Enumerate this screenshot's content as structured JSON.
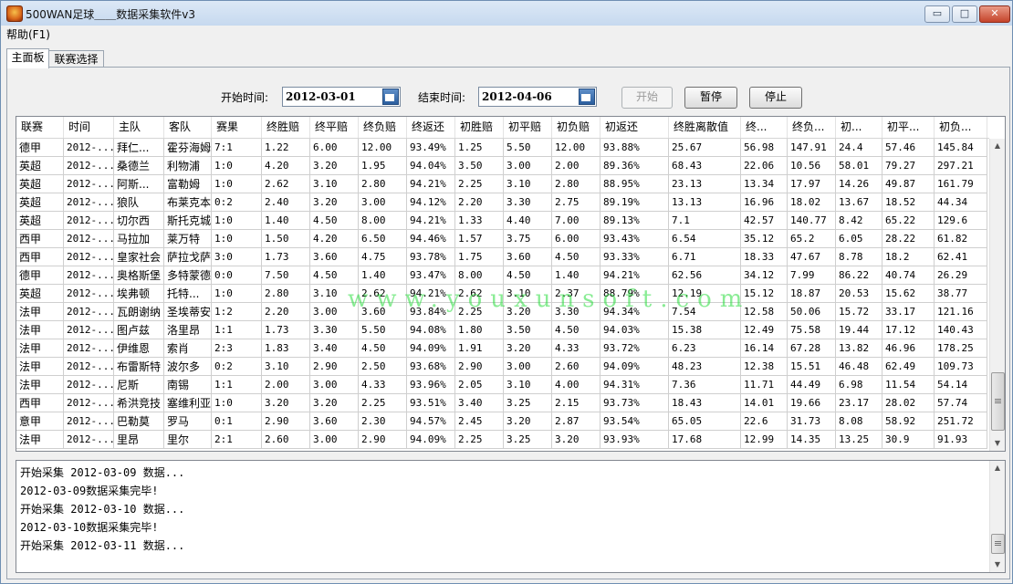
{
  "window": {
    "title": "500WAN足球＿＿数据采集软件v3",
    "minimize": "▭",
    "maximize": "□",
    "close": "✕"
  },
  "menu": {
    "help": "帮助(F1)"
  },
  "tabs": [
    "主面板",
    "联赛选择"
  ],
  "controls": {
    "start_label": "开始时间:",
    "start_value": "2012-03-01",
    "end_label": "结束时间:",
    "end_value": "2012-04-06",
    "btn_start": "开始",
    "btn_pause": "暂停",
    "btn_stop": "停止"
  },
  "table": {
    "headers": [
      "联赛",
      "时间",
      "主队",
      "客队",
      "赛果",
      "终胜赔",
      "终平赔",
      "终负赔",
      "终返还",
      "初胜赔",
      "初平赔",
      "初负赔",
      "初返还",
      "终胜离散值",
      "终...",
      "终负...",
      "初...",
      "初平...",
      "初负..."
    ],
    "rows": [
      [
        "德甲",
        "2012-...",
        "拜仁...",
        "霍芬海姆",
        "7:1",
        "1.22",
        "6.00",
        "12.00",
        "93.49%",
        "1.25",
        "5.50",
        "12.00",
        "93.88%",
        "25.67",
        "56.98",
        "147.91",
        "24.4",
        "57.46",
        "145.84"
      ],
      [
        "英超",
        "2012-...",
        "桑德兰",
        "利物浦",
        "1:0",
        "4.20",
        "3.20",
        "1.95",
        "94.04%",
        "3.50",
        "3.00",
        "2.00",
        "89.36%",
        "68.43",
        "22.06",
        "10.56",
        "58.01",
        "79.27",
        "297.21"
      ],
      [
        "英超",
        "2012-...",
        "阿斯...",
        "富勒姆",
        "1:0",
        "2.62",
        "3.10",
        "2.80",
        "94.21%",
        "2.25",
        "3.10",
        "2.80",
        "88.95%",
        "23.13",
        "13.34",
        "17.97",
        "14.26",
        "49.87",
        "161.79"
      ],
      [
        "英超",
        "2012-...",
        "狼队",
        "布莱克本",
        "0:2",
        "2.40",
        "3.20",
        "3.00",
        "94.12%",
        "2.20",
        "3.30",
        "2.75",
        "89.19%",
        "13.13",
        "16.96",
        "18.02",
        "13.67",
        "18.52",
        "44.34"
      ],
      [
        "英超",
        "2012-...",
        "切尔西",
        "斯托克城",
        "1:0",
        "1.40",
        "4.50",
        "8.00",
        "94.21%",
        "1.33",
        "4.40",
        "7.00",
        "89.13%",
        "7.1",
        "42.57",
        "140.77",
        "8.42",
        "65.22",
        "129.6"
      ],
      [
        "西甲",
        "2012-...",
        "马拉加",
        "莱万特",
        "1:0",
        "1.50",
        "4.20",
        "6.50",
        "94.46%",
        "1.57",
        "3.75",
        "6.00",
        "93.43%",
        "6.54",
        "35.12",
        "65.2",
        "6.05",
        "28.22",
        "61.82"
      ],
      [
        "西甲",
        "2012-...",
        "皇家社会",
        "萨拉戈萨",
        "3:0",
        "1.73",
        "3.60",
        "4.75",
        "93.78%",
        "1.75",
        "3.60",
        "4.50",
        "93.33%",
        "6.71",
        "18.33",
        "47.67",
        "8.78",
        "18.2",
        "62.41"
      ],
      [
        "德甲",
        "2012-...",
        "奥格斯堡",
        "多特蒙德",
        "0:0",
        "7.50",
        "4.50",
        "1.40",
        "93.47%",
        "8.00",
        "4.50",
        "1.40",
        "94.21%",
        "62.56",
        "34.12",
        "7.99",
        "86.22",
        "40.74",
        "26.29"
      ],
      [
        "英超",
        "2012-...",
        "埃弗顿",
        "托特...",
        "1:0",
        "2.80",
        "3.10",
        "2.62",
        "94.21%",
        "2.62",
        "3.10",
        "2.37",
        "88.79%",
        "12.19",
        "15.12",
        "18.87",
        "20.53",
        "15.62",
        "38.77"
      ],
      [
        "法甲",
        "2012-...",
        "瓦朗谢纳",
        "圣埃蒂安",
        "1:2",
        "2.20",
        "3.00",
        "3.60",
        "93.84%",
        "2.25",
        "3.20",
        "3.30",
        "94.34%",
        "7.54",
        "12.58",
        "50.06",
        "15.72",
        "33.17",
        "121.16"
      ],
      [
        "法甲",
        "2012-...",
        "图卢兹",
        "洛里昂",
        "1:1",
        "1.73",
        "3.30",
        "5.50",
        "94.08%",
        "1.80",
        "3.50",
        "4.50",
        "94.03%",
        "15.38",
        "12.49",
        "75.58",
        "19.44",
        "17.12",
        "140.43"
      ],
      [
        "法甲",
        "2012-...",
        "伊维恩",
        "索肖",
        "2:3",
        "1.83",
        "3.40",
        "4.50",
        "94.09%",
        "1.91",
        "3.20",
        "4.33",
        "93.72%",
        "6.23",
        "16.14",
        "67.28",
        "13.82",
        "46.96",
        "178.25"
      ],
      [
        "法甲",
        "2012-...",
        "布雷斯特",
        "波尔多",
        "0:2",
        "3.10",
        "2.90",
        "2.50",
        "93.68%",
        "2.90",
        "3.00",
        "2.60",
        "94.09%",
        "48.23",
        "12.38",
        "15.51",
        "46.48",
        "62.49",
        "109.73"
      ],
      [
        "法甲",
        "2012-...",
        "尼斯",
        "南锡",
        "1:1",
        "2.00",
        "3.00",
        "4.33",
        "93.96%",
        "2.05",
        "3.10",
        "4.00",
        "94.31%",
        "7.36",
        "11.71",
        "44.49",
        "6.98",
        "11.54",
        "54.14"
      ],
      [
        "西甲",
        "2012-...",
        "希洪竞技",
        "塞维利亚",
        "1:0",
        "3.20",
        "3.20",
        "2.25",
        "93.51%",
        "3.40",
        "3.25",
        "2.15",
        "93.73%",
        "18.43",
        "14.01",
        "19.66",
        "23.17",
        "28.02",
        "57.74"
      ],
      [
        "意甲",
        "2012-...",
        "巴勒莫",
        "罗马",
        "0:1",
        "2.90",
        "3.60",
        "2.30",
        "94.57%",
        "2.45",
        "3.20",
        "2.87",
        "93.54%",
        "65.05",
        "22.6",
        "31.73",
        "8.08",
        "58.92",
        "251.72"
      ],
      [
        "法甲",
        "2012-...",
        "里昂",
        "里尔",
        "2:1",
        "2.60",
        "3.00",
        "2.90",
        "94.09%",
        "2.25",
        "3.25",
        "3.20",
        "93.93%",
        "17.68",
        "12.99",
        "14.35",
        "13.25",
        "30.9",
        "91.93"
      ]
    ]
  },
  "log": [
    "开始采集 2012-03-09 数据...",
    "2012-03-09数据采集完毕!",
    "开始采集 2012-03-10 数据...",
    "2012-03-10数据采集完毕!",
    "开始采集 2012-03-11 数据..."
  ],
  "watermark": "www.youxunsoft.com",
  "icons": {
    "scroll_up": "up-arrow-icon",
    "scroll_down": "down-arrow-icon"
  }
}
